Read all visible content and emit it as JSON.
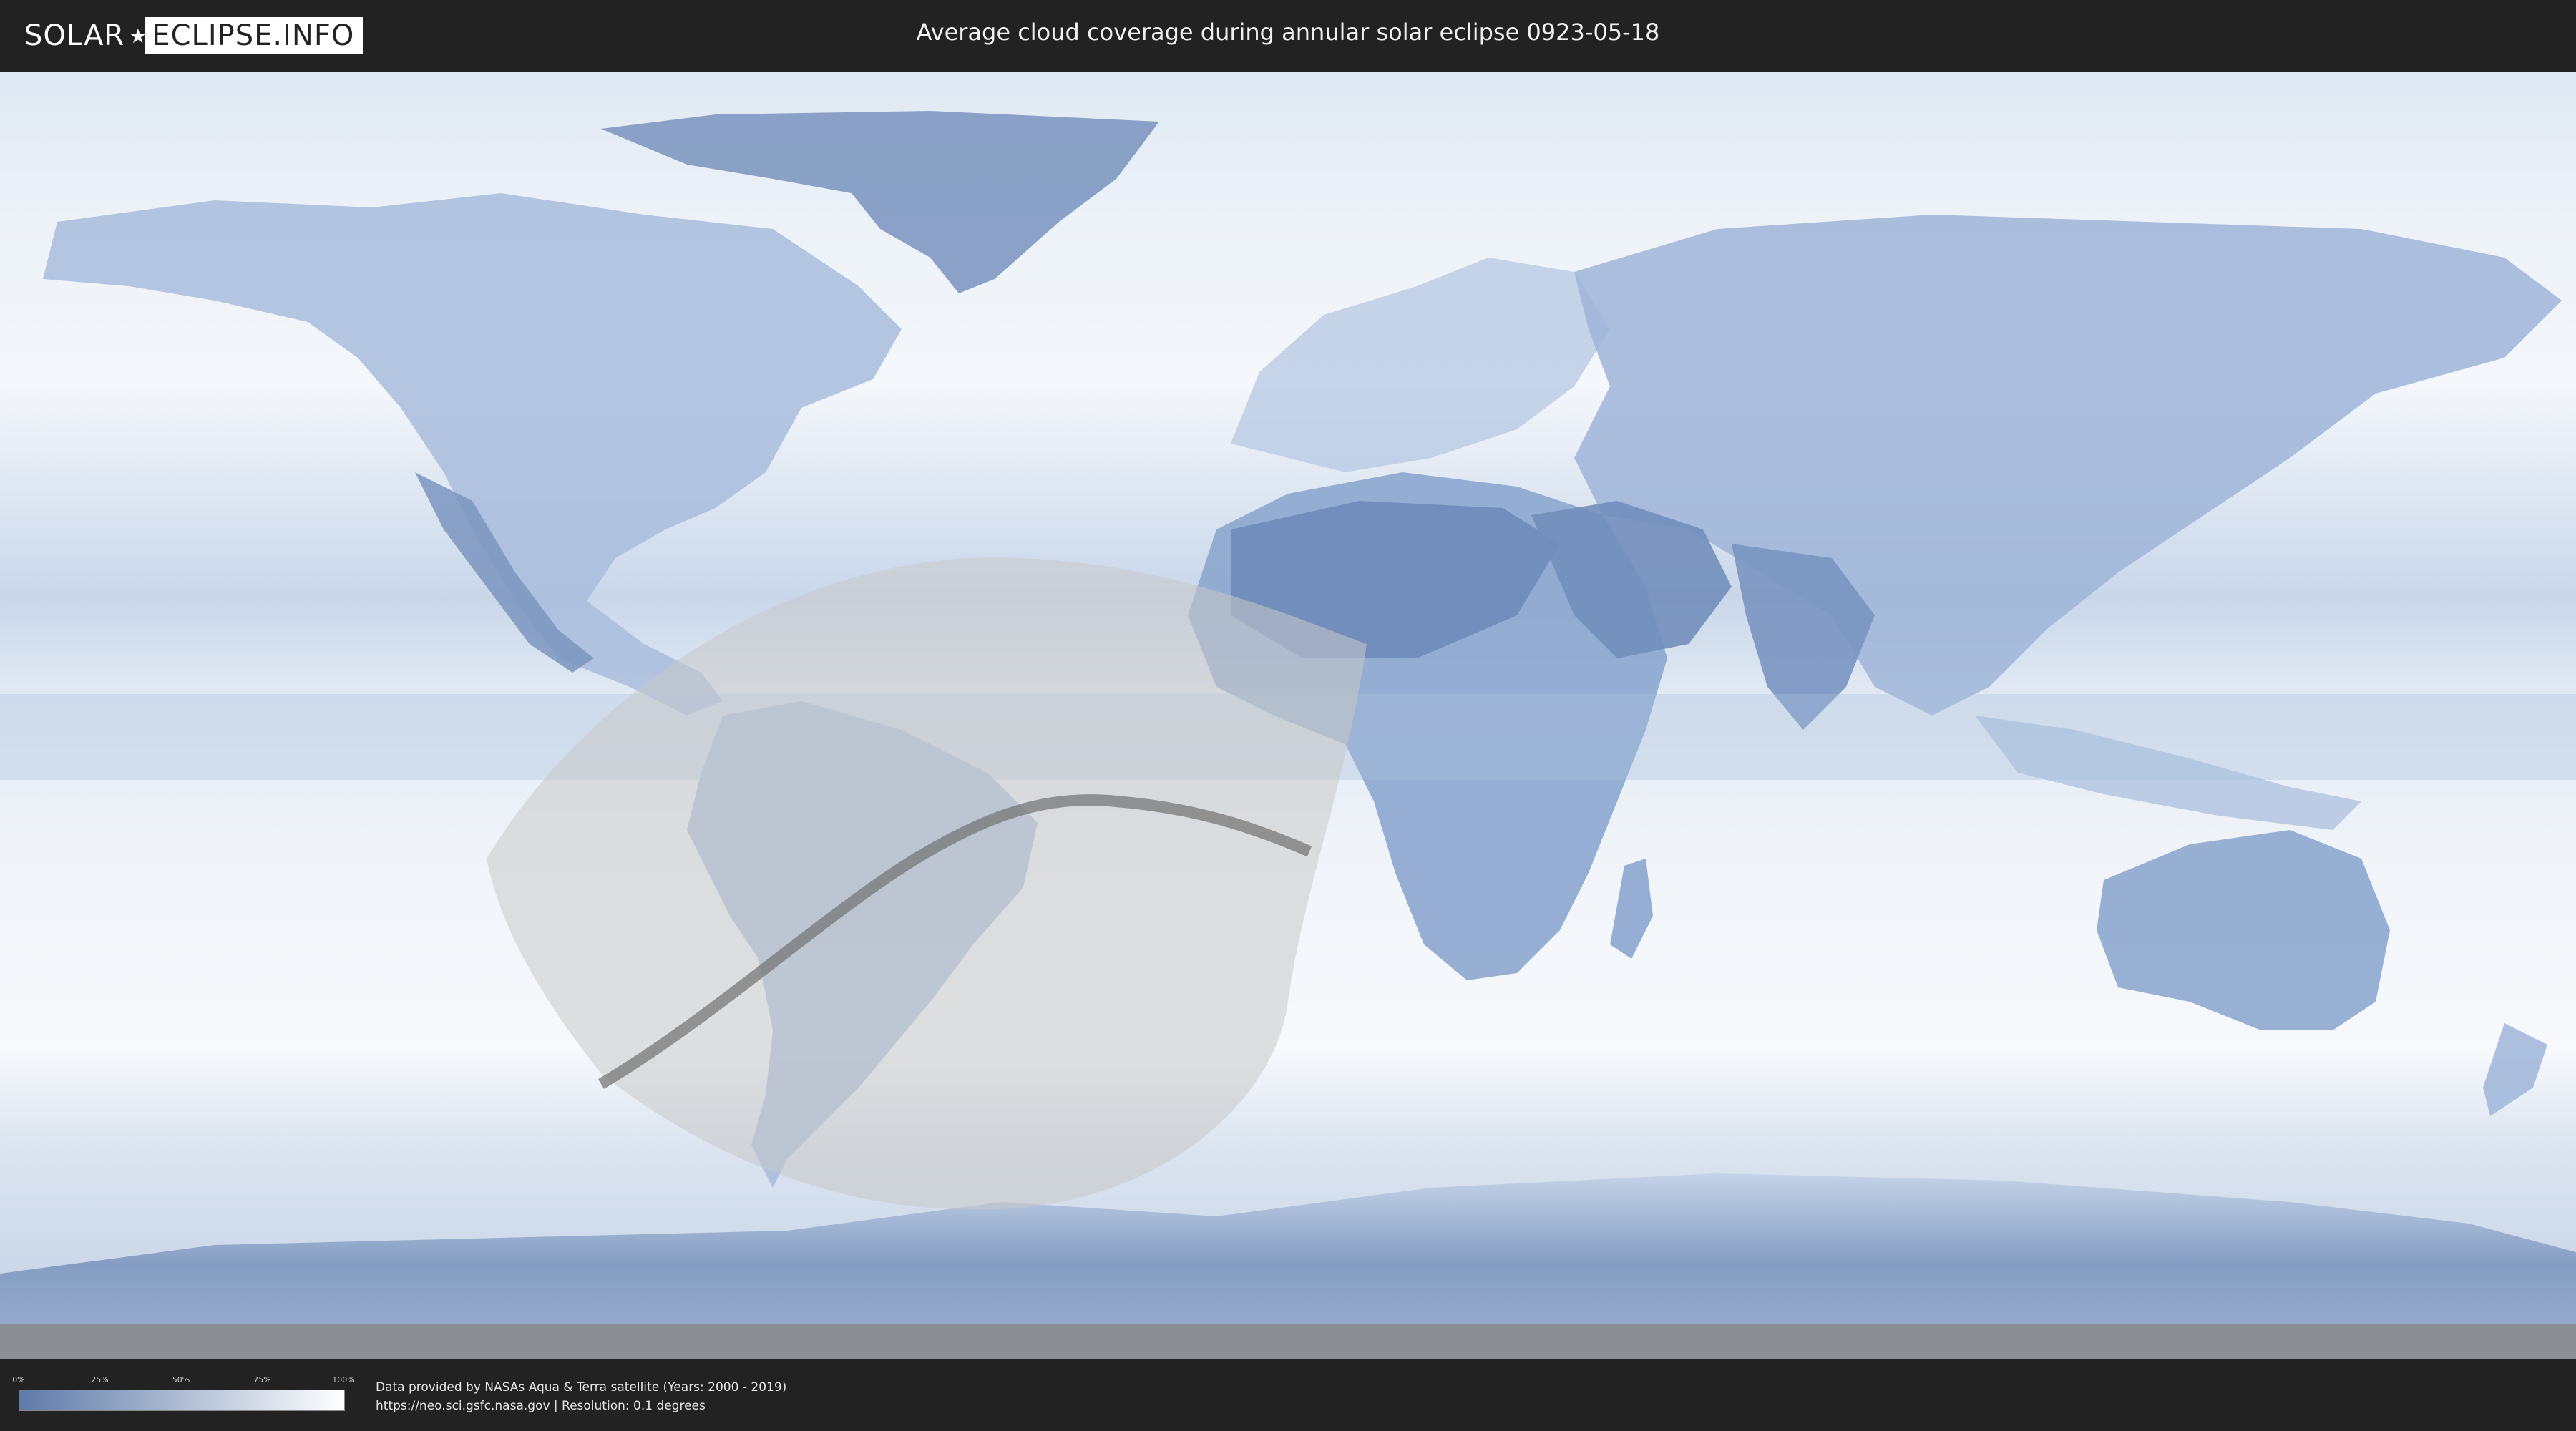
{
  "header": {
    "logo_left": "SOLAR",
    "logo_right": "ECLIPSE.INFO",
    "title": "Average cloud coverage during annular solar eclipse 0923-05-18"
  },
  "legend": {
    "ticks": [
      "0%",
      "25%",
      "50%",
      "75%",
      "100%"
    ],
    "colors": {
      "low": "#5f7aa8",
      "high": "#ffffff"
    }
  },
  "credits": {
    "line1": "Data provided by NASAs Aqua & Terra satellite (Years: 2000 - 2019)",
    "line2": "https://neo.sci.gsfc.nasa.gov | Resolution: 0.1 degrees"
  },
  "map": {
    "colors": {
      "ocean": "#e8eef6",
      "land_cloudy": "#8ea7cc",
      "land_clear": "#6e8bb8",
      "ice": "#b9c9e0",
      "eclipse_zone": "#c8c8c8",
      "central_line": "#777777"
    }
  }
}
